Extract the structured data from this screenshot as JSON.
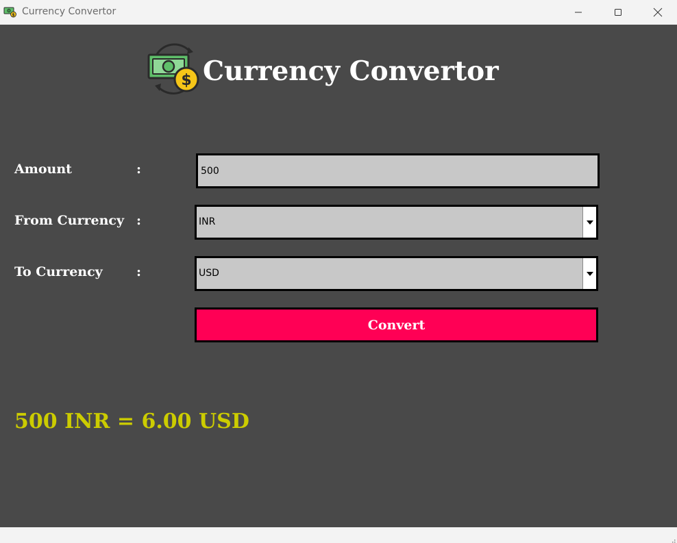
{
  "window": {
    "title": "Currency Convertor",
    "app_icon": "money-exchange-icon",
    "controls": [
      "minimize-icon",
      "maximize-icon",
      "close-icon"
    ]
  },
  "header": {
    "logo_icon": "money-exchange-icon",
    "title": "Currency Convertor"
  },
  "form": {
    "amount": {
      "label": "Amount",
      "colon": ":",
      "value": "500"
    },
    "from_currency": {
      "label": "From Currency",
      "colon": ":",
      "selected": "INR"
    },
    "to_currency": {
      "label": "To Currency",
      "colon": ":",
      "selected": "USD"
    },
    "convert_label": "Convert"
  },
  "result": {
    "text": "500 INR = 6.00 USD"
  },
  "colors": {
    "background": "#494949",
    "field_bg": "#c8c8c8",
    "button_bg": "#ff0055",
    "result_text": "#cccc00",
    "title_text": "#ffffff"
  }
}
